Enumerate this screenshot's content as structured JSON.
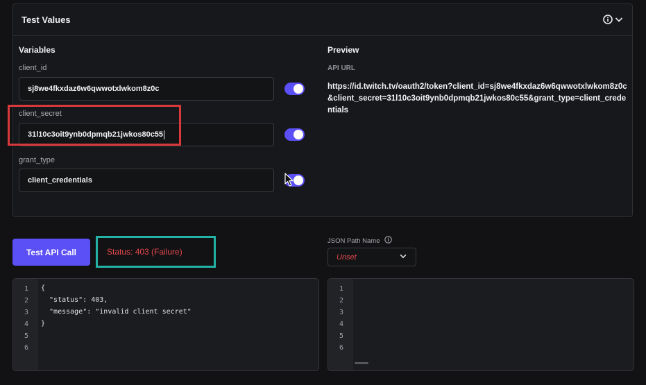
{
  "panel": {
    "title": "Test Values"
  },
  "variables": {
    "heading": "Variables",
    "items": [
      {
        "label": "client_id",
        "value": "sj8we4fkxdaz6w6qwwotxlwkom8z0c",
        "enabled": true
      },
      {
        "label": "client_secret",
        "value": "31l10c3oit9ynb0dpmqb21jwkos80c55",
        "enabled": true
      },
      {
        "label": "grant_type",
        "value": "client_credentials",
        "enabled": true
      }
    ]
  },
  "preview": {
    "heading": "Preview",
    "subheading": "API URL",
    "url": "https://id.twitch.tv/oauth2/token?client_id=sj8we4fkxdaz6w6qwwotxlwkom8z0c&client_secret=31l10c3oit9ynb0dpmqb21jwkos80c55&grant_type=client_credentials"
  },
  "actions": {
    "test_button": "Test API Call"
  },
  "status": {
    "text": "Status:  403 (Failure)",
    "color": "#e5484d"
  },
  "json_path": {
    "label": "JSON Path Name",
    "value": "Unset"
  },
  "response_code": {
    "line_numbers": [
      "1",
      "2",
      "3",
      "4",
      "5",
      "6"
    ],
    "lines": [
      "{",
      "  \"status\": 403,",
      "  \"message\": \"invalid client secret\"",
      "}"
    ]
  },
  "json_output": {
    "line_numbers": [
      "1",
      "2",
      "3",
      "4",
      "5",
      "6"
    ]
  },
  "colors": {
    "accent": "#5b4ff6",
    "highlight_red": "#d9393b",
    "highlight_teal": "#23b3a6"
  }
}
